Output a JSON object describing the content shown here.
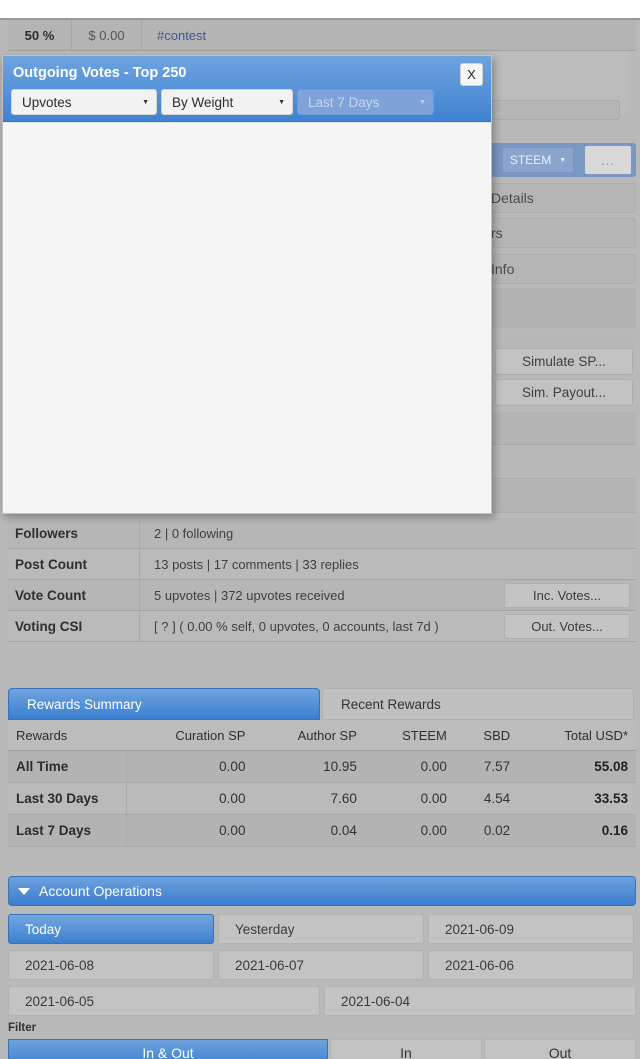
{
  "background": {
    "top_row": {
      "percent": "50 %",
      "usd": "$ 0.00",
      "tag": "#contest"
    },
    "toolbar": {
      "steem_dropdown": "STEEM",
      "more_button": "..."
    },
    "hidden_buttons": [
      {
        "label": "Details"
      },
      {
        "label": "rs"
      },
      {
        "label": "Info"
      }
    ],
    "sim_buttons": [
      {
        "label": "Simulate SP..."
      },
      {
        "label": "Sim. Payout..."
      }
    ],
    "stats": [
      {
        "label": "Followers",
        "value": "2  |  0 following",
        "action": null
      },
      {
        "label": "Post Count",
        "value": "13 posts  |  17 comments  |  33 replies",
        "action": null
      },
      {
        "label": "Vote Count",
        "value": "5 upvotes  |  372 upvotes received",
        "action": "Inc. Votes..."
      },
      {
        "label": "Voting CSI",
        "value": "[ ? ] ( 0.00 % self, 0 upvotes, 0 accounts, last 7d )",
        "action": "Out. Votes..."
      }
    ],
    "rewards": {
      "tabs": [
        {
          "label": "Rewards Summary",
          "active": true
        },
        {
          "label": "Recent Rewards",
          "active": false
        }
      ],
      "columns": [
        "Rewards",
        "Curation SP",
        "Author SP",
        "STEEM",
        "SBD",
        "Total USD*"
      ],
      "rows": [
        {
          "period": "All Time",
          "curation_sp": "0.00",
          "author_sp": "10.95",
          "steem": "0.00",
          "sbd": "7.57",
          "total_usd": "55.08"
        },
        {
          "period": "Last 30 Days",
          "curation_sp": "0.00",
          "author_sp": "7.60",
          "steem": "0.00",
          "sbd": "4.54",
          "total_usd": "33.53"
        },
        {
          "period": "Last 7 Days",
          "curation_sp": "0.00",
          "author_sp": "0.04",
          "steem": "0.00",
          "sbd": "0.02",
          "total_usd": "0.16"
        }
      ]
    },
    "account_operations": {
      "title": "Account Operations",
      "dates_row1": [
        {
          "label": "Today",
          "active": true
        },
        {
          "label": "Yesterday",
          "active": false
        },
        {
          "label": "2021-06-09",
          "active": false
        }
      ],
      "dates_row2": [
        {
          "label": "2021-06-08",
          "active": false
        },
        {
          "label": "2021-06-07",
          "active": false
        },
        {
          "label": "2021-06-06",
          "active": false
        }
      ],
      "dates_row3": [
        {
          "label": "2021-06-05",
          "active": false
        },
        {
          "label": "2021-06-04",
          "active": false
        }
      ],
      "filter_label": "Filter",
      "filters": [
        {
          "label": "In & Out",
          "active": true
        },
        {
          "label": "In",
          "active": false
        },
        {
          "label": "Out",
          "active": false
        }
      ]
    }
  },
  "modal": {
    "title": "Outgoing Votes - Top 250",
    "close_label": "X",
    "controls": [
      {
        "value": "Upvotes",
        "disabled": false
      },
      {
        "value": "By Weight",
        "disabled": false
      },
      {
        "value": "Last 7 Days",
        "disabled": true
      }
    ],
    "body_content": ""
  },
  "colors": {
    "accent_blue": "#3f83d2",
    "page_gray": "#b9b9b9",
    "link_blue": "#3b5b8c",
    "modal_body": "#f5f5f5"
  }
}
